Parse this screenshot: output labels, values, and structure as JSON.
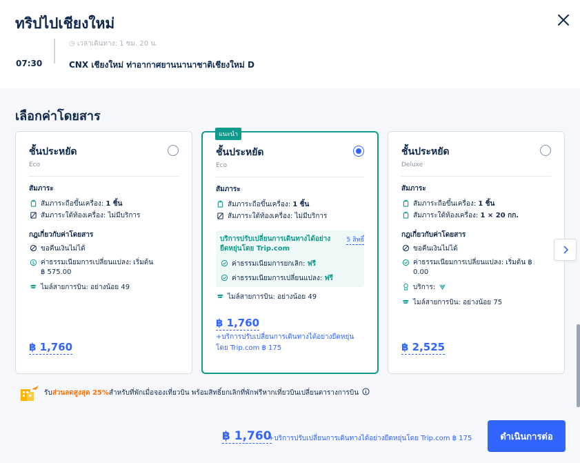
{
  "header": {
    "title": "ทริปไปเชียงใหม่",
    "duration_text": "เวลาเดินทาง: 1 ชม. 20 น.",
    "arrival_time": "07:30",
    "arrival_airport": "CNX เชียงใหม่ ท่าอากาศยานนานาชาติเชียงใหม่ D"
  },
  "section_title": "เลือกค่าโดยสาร",
  "cards": [
    {
      "name": "ชั้นประหยัด",
      "sub": "Eco",
      "baggage_label": "สัมภาระ",
      "carry_on_label": "สัมภาระถือขึ้นเครื่อง:",
      "carry_on_value": "1 ชิ้น",
      "checked_label": "สัมภาระใต้ท้องเครื่อง:",
      "checked_value": "ไม่มีบริการ",
      "rules_label": "กฎเกี่ยวกับค่าโดยสาร",
      "refund": "ขอคืนเงินไม่ได้",
      "change_fee": "ค่าธรรมเนียมการเปลี่ยนแปลง: เริ่มต้น ฿ 575.00",
      "miles": "ไมล์สายการบิน: อย่างน้อย 49",
      "price": "฿ 1,760"
    },
    {
      "badge": "แนะนำ",
      "name": "ชั้นประหยัด",
      "sub": "Eco",
      "baggage_label": "สัมภาระ",
      "carry_on_label": "สัมภาระถือขึ้นเครื่อง:",
      "carry_on_value": "1 ชิ้น",
      "checked_label": "สัมภาระใต้ท้องเครื่อง:",
      "checked_value": "ไม่มีบริการ",
      "flex_title": "บริการปรับเปลี่ยนการเดินทางได้อย่างยืดหยุ่นโดย Trip.com",
      "flex_link": "5 สิทธิ์",
      "cancel_fee_label": "ค่าธรรมเนียมการยกเลิก:",
      "cancel_fee_value": "ฟรี",
      "change_fee_label": "ค่าธรรมเนียมการเปลี่ยนแปลง:",
      "change_fee_value": "ฟรี",
      "miles": "ไมล์สายการบิน: อย่างน้อย 49",
      "price": "฿ 1,760",
      "addon_note": "+บริการปรับเปลี่ยนการเดินทางได้อย่างยืดหยุ่นโดย Trip.com ฿ 175"
    },
    {
      "name": "ชั้นประหยัด",
      "sub": "Deluxe",
      "baggage_label": "สัมภาระ",
      "carry_on_label": "สัมภาระถือขึ้นเครื่อง:",
      "carry_on_value": "1 ชิ้น",
      "checked_label": "สัมภาระใต้ท้องเครื่อง:",
      "checked_value": "1 × 20 กก.",
      "rules_label": "กฎเกี่ยวกับค่าโดยสาร",
      "refund": "ขอคืนเงินไม่ได้",
      "change_fee": "ค่าธรรมเนียมการเปลี่ยนแปลง: เริ่มต้น ฿ 0.00",
      "service_label": "บริการ:",
      "miles": "ไมล์สายการบิน: อย่างน้อย 75",
      "price": "฿ 2,525"
    }
  ],
  "promo": {
    "prefix": "รับ",
    "highlight": "ส่วนลดสูงสุด 25%",
    "suffix": " สำหรับที่พักเมื่อจองเที่ยวบิน พร้อมสิทธิ์ยกเลิกที่พักฟรีหากเที่ยวบินเปลี่ยนตารางการบิน"
  },
  "footer": {
    "price": "฿ 1,760",
    "note": "+บริการปรับเปลี่ยนการเดินทางได้อย่างยืดหยุ่นโดย Trip.com ฿ 175",
    "continue_label": "ดำเนินการต่อ"
  },
  "colors": {
    "accent": "#3264ff",
    "teal": "#0e9a8c",
    "promo": "#ff6f00",
    "text": "#0f294d"
  }
}
